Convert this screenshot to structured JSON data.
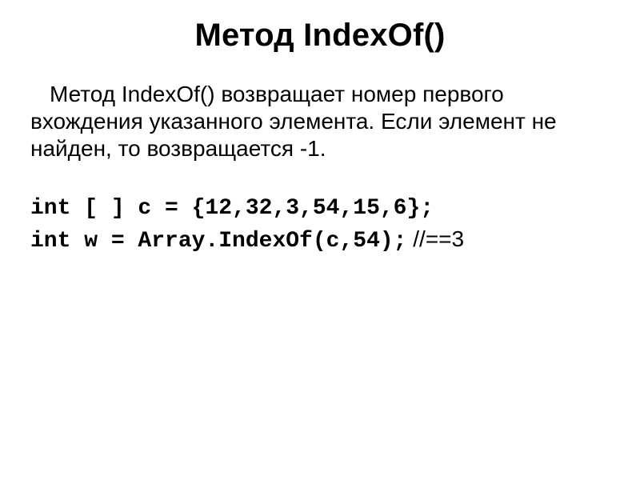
{
  "slide": {
    "title": "Метод IndexOf()",
    "paragraph": "Метод IndexOf() возвращает номер первого вхождения указанного элемента. Если элемент не найден, то возвращается -1.",
    "code": {
      "line1": "int [ ] c = {12,32,3,54,15,6};",
      "line2_code": "int w = Array.IndexOf(c,54);",
      "line2_comment": " //==3"
    }
  }
}
